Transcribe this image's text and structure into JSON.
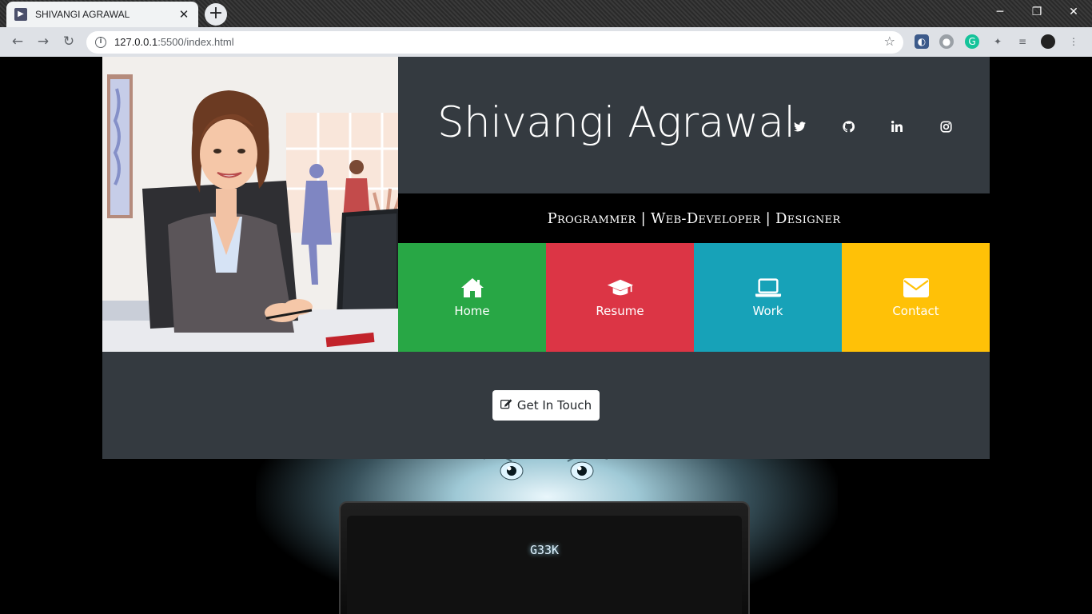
{
  "browser": {
    "tab_title": "SHIVANGI AGRAWAL",
    "tab_close": "✕",
    "new_tab": "+",
    "url_host": "127.0.0.1",
    "url_path": ":5500/index.html"
  },
  "site": {
    "name": "Shivangi Agrawal",
    "tagline": "Programmer | Web-Developer | Designer",
    "social": [
      "twitter-icon",
      "github-icon",
      "linkedin-icon",
      "instagram-icon"
    ],
    "tiles": [
      {
        "label": "Home",
        "icon": "home-icon",
        "color": "#28a745"
      },
      {
        "label": "Resume",
        "icon": "graduation-cap-icon",
        "color": "#dc3545"
      },
      {
        "label": "Work",
        "icon": "laptop-icon",
        "color": "#17a2b8"
      },
      {
        "label": "Contact",
        "icon": "envelope-icon",
        "color": "#ffc107"
      }
    ],
    "cta_label": "Get In Touch",
    "laptop_logo": "G33K"
  }
}
